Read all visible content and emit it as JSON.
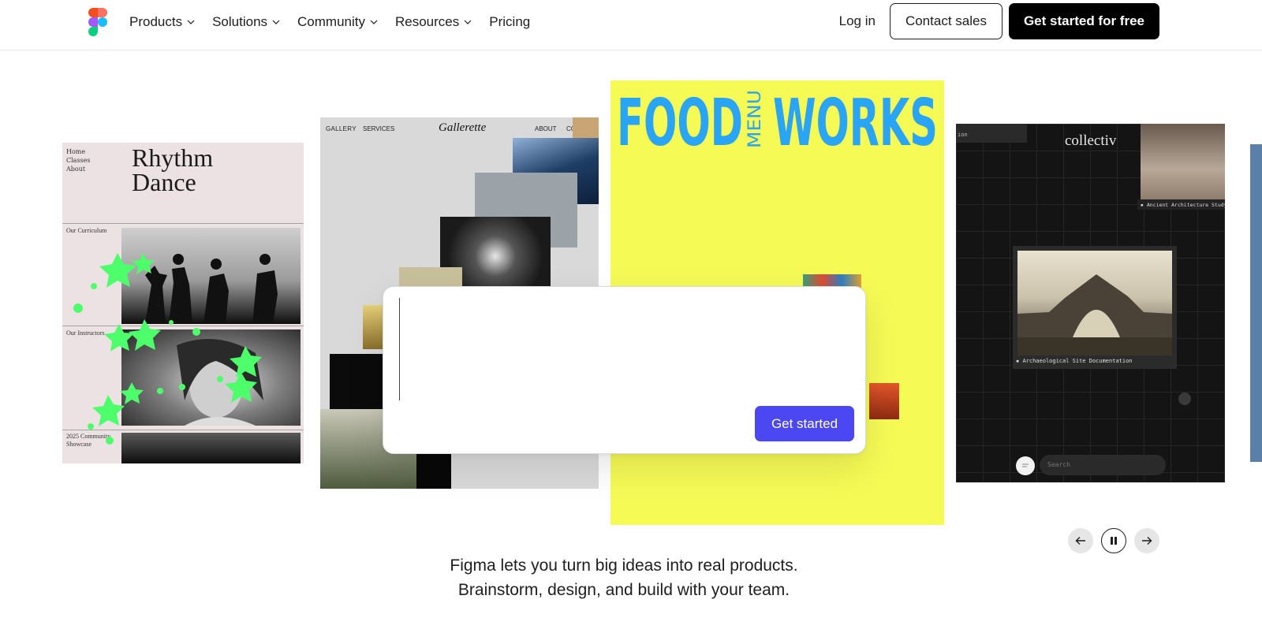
{
  "nav": {
    "logo_icon": "figma-logo-icon",
    "items": [
      {
        "label": "Products",
        "has_dropdown": true
      },
      {
        "label": "Solutions",
        "has_dropdown": true
      },
      {
        "label": "Community",
        "has_dropdown": true
      },
      {
        "label": "Resources",
        "has_dropdown": true
      },
      {
        "label": "Pricing",
        "has_dropdown": false
      }
    ],
    "login": "Log in",
    "contact_sales": "Contact sales",
    "get_started_free": "Get started for free"
  },
  "carousel": {
    "cards": {
      "rhythm": {
        "nav": [
          "Home",
          "Classes",
          "About"
        ],
        "title_line1": "Rhythm",
        "title_line2": "Dance",
        "section1": "Our Curriculum",
        "section2": "Our Instructors",
        "section3_line1": "2025 Community",
        "section3_line2": "Showcase"
      },
      "gallery": {
        "nav_gallery": "GALLERY",
        "nav_services": "SERVICES",
        "logo": "Gallerette",
        "nav_about": "ABOUT",
        "nav_contact": "CONTACT"
      },
      "food": {
        "word1": "FOOD",
        "word_mid": "MENU",
        "word2": "WORKS",
        "accent": "#2aa4f4",
        "background": "#f5fa55"
      },
      "collectiv": {
        "logo": "collectiv",
        "tag": "ion",
        "caption_a": "Ancient Architecture Study",
        "caption_b": "Archaeological Site Documentation",
        "search_placeholder": "Search"
      }
    },
    "controls": {
      "prev_icon": "arrow-left-icon",
      "pause_icon": "pause-icon",
      "next_icon": "arrow-right-icon"
    }
  },
  "prompt": {
    "placeholder": "",
    "button": "Get started",
    "button_color": "#4b47f2"
  },
  "tagline": {
    "line1": "Figma lets you turn big ideas into real products.",
    "line2": "Brainstorm, design, and build with your team."
  }
}
